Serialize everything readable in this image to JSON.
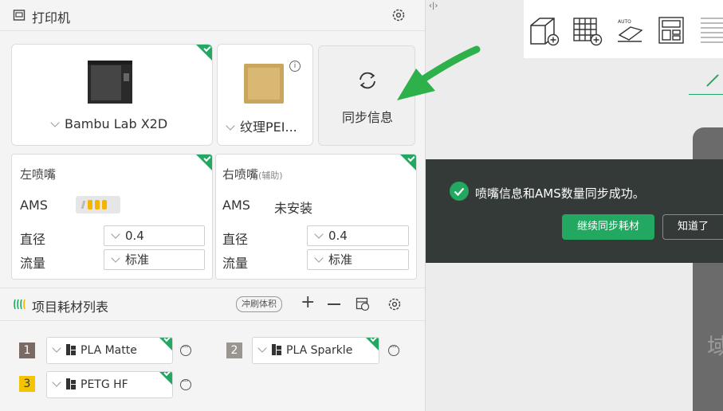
{
  "printer_section": {
    "title": "打印机"
  },
  "printer_card": {
    "name": "Bambu Lab X2D"
  },
  "plate_card": {
    "name": "纹理PEI...",
    "info_icon": "info-icon"
  },
  "sync_button": {
    "label": "同步信息"
  },
  "left_nozzle": {
    "title": "左喷嘴",
    "ams_label": "AMS",
    "diameter_label": "直径",
    "diameter_value": "0.4",
    "flow_label": "流量",
    "flow_value": "标准"
  },
  "right_nozzle": {
    "title": "右喷嘴",
    "title_sub": "(辅助)",
    "ams_label": "AMS",
    "ams_value": "未安装",
    "diameter_label": "直径",
    "diameter_value": "0.4",
    "flow_label": "流量",
    "flow_value": "标准"
  },
  "filament_section": {
    "title": "项目耗材列表",
    "flush_label": "冲刷体积"
  },
  "filaments": [
    {
      "num": "1",
      "name": "PLA Matte",
      "color": "#7a6a64"
    },
    {
      "num": "2",
      "name": "PLA Sparkle",
      "color": "#9a958f"
    },
    {
      "num": "3",
      "name": "PETG HF",
      "color": "#f5c400"
    }
  ],
  "toast": {
    "message": "喷嘴信息和AMS数量同步成功。",
    "continue_label": "继续同步耗材",
    "ok_label": "知道了"
  },
  "plate_text": "打印区域",
  "colors": {
    "accent": "#22a861",
    "toast_bg": "#343a37"
  }
}
